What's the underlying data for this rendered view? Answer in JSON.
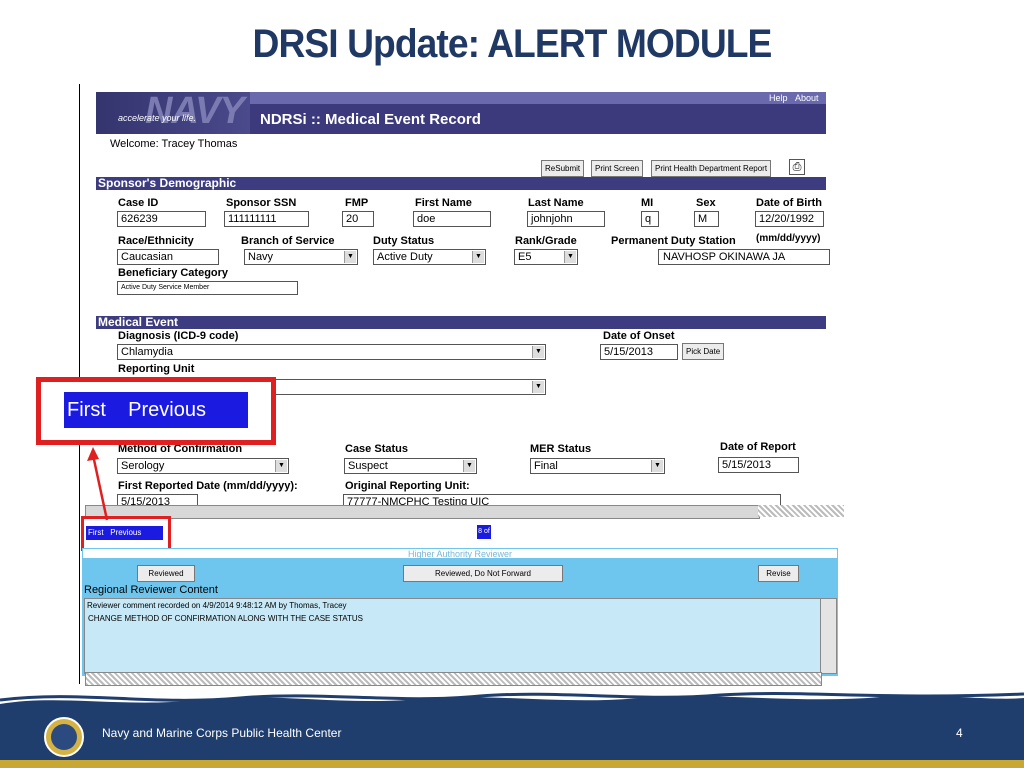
{
  "slide": {
    "title": "DRSI Update: ALERT MODULE",
    "footer_text": "Navy and Marine Corps Public Health Center",
    "page_number": "4"
  },
  "app": {
    "logo_word": "NAVY",
    "logo_tagline": "accelerate your life.",
    "title": "NDRSi :: Medical Event Record",
    "links": [
      "Help",
      "About"
    ],
    "welcome": "Welcome: Tracey Thomas",
    "toolbar": {
      "resubmit": "ReSubmit",
      "print_screen": "Print Screen",
      "print_health": "Print Health Department Report"
    }
  },
  "sponsor": {
    "section_title": "Sponsor's Demographic",
    "labels": {
      "case_id": "Case ID",
      "ssn": "Sponsor SSN",
      "fmp": "FMP",
      "first_name": "First Name",
      "last_name": "Last Name",
      "mi": "MI",
      "sex": "Sex",
      "dob": "Date of Birth",
      "dob_format": "(mm/dd/yyyy)",
      "race": "Race/Ethnicity",
      "branch": "Branch of Service",
      "duty_status": "Duty Status",
      "rank": "Rank/Grade",
      "duty_station": "Permanent Duty Station",
      "beneficiary": "Beneficiary Category"
    },
    "values": {
      "case_id": "626239",
      "ssn": "111111111",
      "fmp": "20",
      "first_name": "doe",
      "last_name": "johnjohn",
      "mi": "q",
      "sex": "M",
      "dob": "12/20/1992",
      "race": "Caucasian",
      "branch": "Navy",
      "duty_status": "Active Duty",
      "rank": "E5",
      "duty_station": "NAVHOSP OKINAWA JA",
      "beneficiary": "Active Duty Service Member"
    }
  },
  "medical": {
    "section_title": "Medical Event",
    "labels": {
      "diagnosis": "Diagnosis (ICD-9 code)",
      "onset": "Date of Onset",
      "reporting_unit": "Reporting Unit",
      "method": "Method of Confirmation",
      "case_status": "Case Status",
      "mer_status": "MER Status",
      "report_date": "Date of Report",
      "first_reported": "First Reported Date (mm/dd/yyyy):",
      "original_unit": "Original Reporting Unit:"
    },
    "values": {
      "diagnosis": "Chlamydia",
      "onset": "5/15/2013",
      "method": "Serology",
      "case_status": "Suspect",
      "mer_status": "Final",
      "report_date": "5/15/2013",
      "first_reported": "5/15/2013",
      "original_unit": "77777-NMCPHC Testing UIC"
    },
    "pick_date": "Pick Date"
  },
  "pager": {
    "first": "First",
    "previous": "Previous",
    "count": "8 of 8"
  },
  "callout": {
    "first": "First",
    "previous": "Previous"
  },
  "reviewer": {
    "header": "Higher Authority Reviewer",
    "buttons": {
      "reviewed": "Reviewed",
      "reviewed_no_forward": "Reviewed, Do Not Forward",
      "revise": "Revise"
    },
    "regional_label": "Regional Reviewer Content",
    "comments": [
      "Reviewer comment recorded on 4/9/2014 9:48:12 AM by Thomas, Tracey",
      "CHANGE METHOD OF CONFIRMATION ALONG WITH THE CASE STATUS"
    ]
  }
}
